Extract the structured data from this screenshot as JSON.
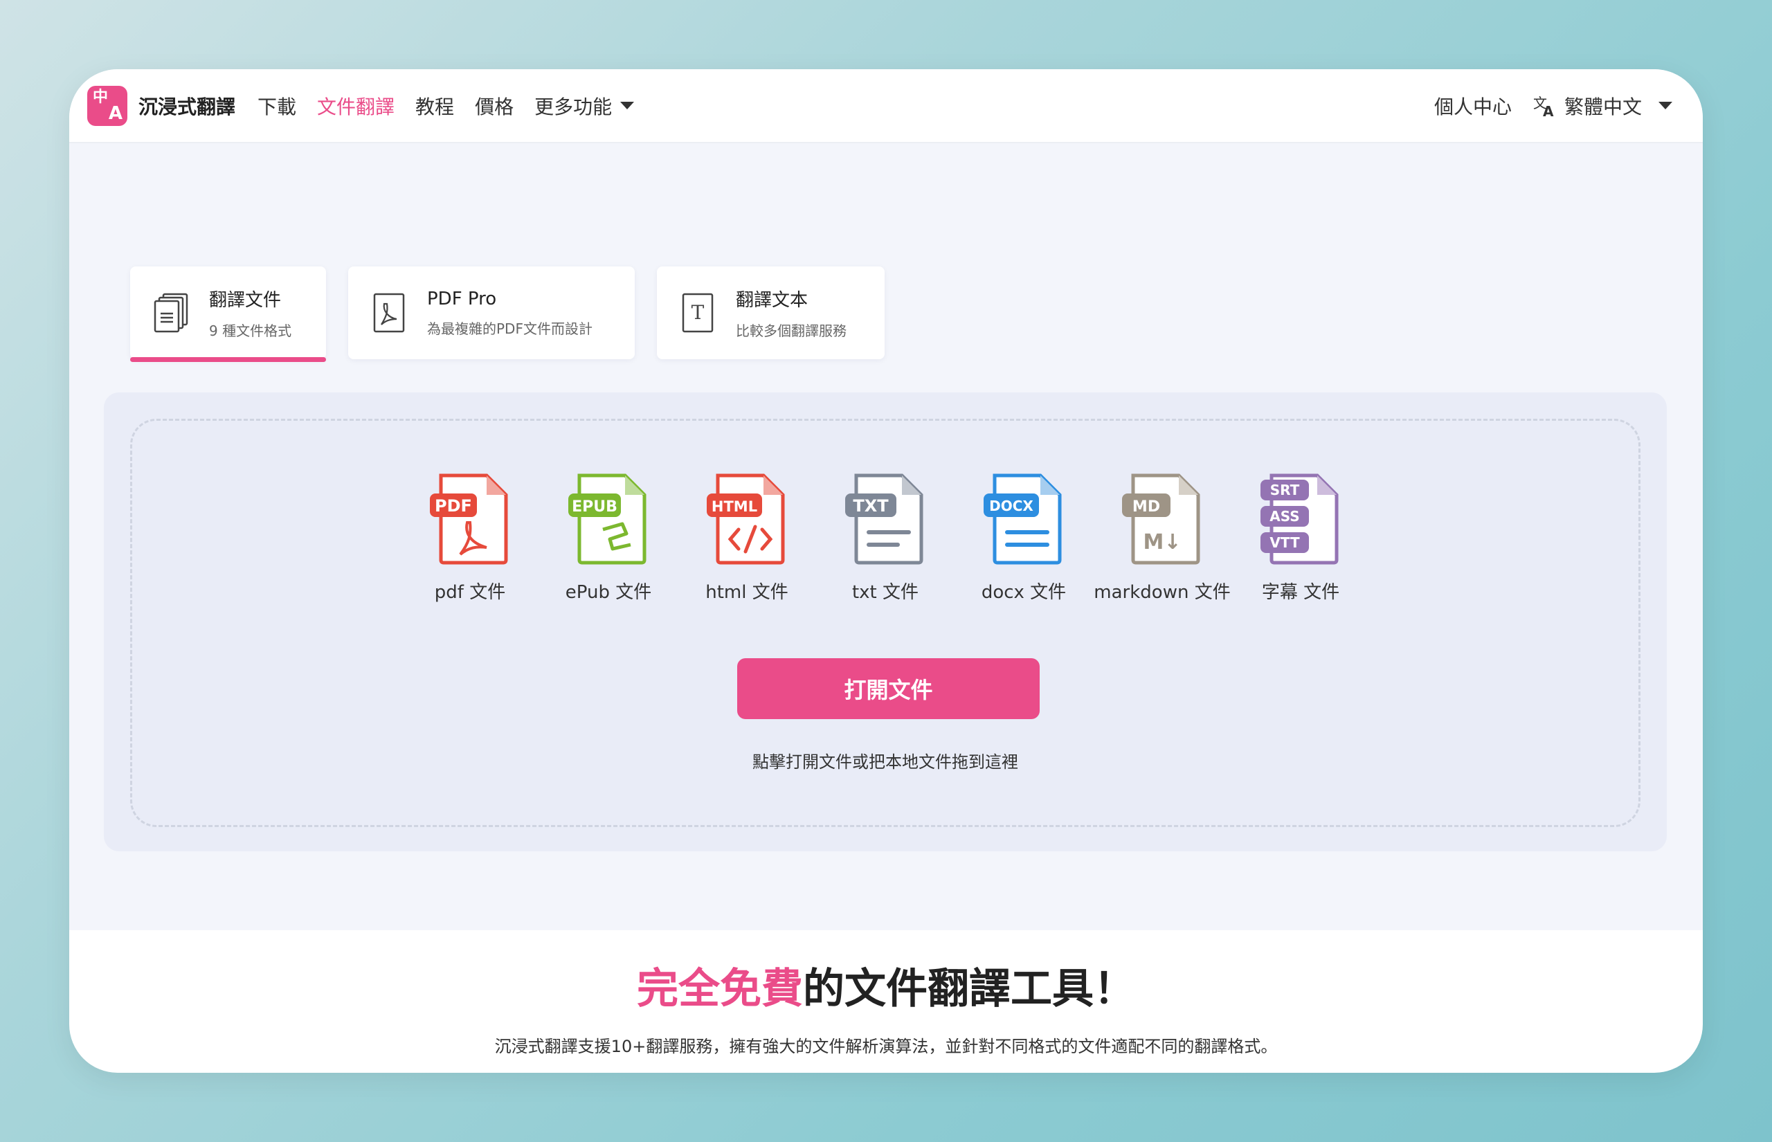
{
  "header": {
    "brand": "沉浸式翻譯",
    "nav": [
      {
        "label": "下載",
        "active": false
      },
      {
        "label": "文件翻譯",
        "active": true
      },
      {
        "label": "教程",
        "active": false
      },
      {
        "label": "價格",
        "active": false
      },
      {
        "label": "更多功能",
        "active": false,
        "dropdown": true
      }
    ],
    "user_center": "個人中心",
    "language": "繁體中文"
  },
  "tabs": [
    {
      "title": "翻譯文件",
      "subtitle": "9 種文件格式",
      "icon": "documents-icon",
      "active": true
    },
    {
      "title": "PDF Pro",
      "subtitle": "為最複雜的PDF文件而設計",
      "icon": "pdf-acrobat-icon",
      "active": false
    },
    {
      "title": "翻譯文本",
      "subtitle": "比較多個翻譯服務",
      "icon": "text-icon",
      "active": false
    }
  ],
  "formats": [
    {
      "badge": "PDF",
      "label": "pdf 文件",
      "color": "#e64a3b",
      "icon": "pdf-file-icon"
    },
    {
      "badge": "EPUB",
      "label": "ePub 文件",
      "color": "#7cb82f",
      "icon": "epub-file-icon"
    },
    {
      "badge": "HTML",
      "label": "html 文件",
      "color": "#e64a3b",
      "icon": "html-file-icon"
    },
    {
      "badge": "TXT",
      "label": "txt 文件",
      "color": "#7e8796",
      "icon": "txt-file-icon"
    },
    {
      "badge": "DOCX",
      "label": "docx 文件",
      "color": "#2d8ee0",
      "icon": "docx-file-icon"
    },
    {
      "badge": "MD",
      "label": "markdown 文件",
      "color": "#9e9486",
      "icon": "markdown-file-icon"
    },
    {
      "badge": "SRT ASS VTT",
      "label": "字幕 文件",
      "color": "#9474b3",
      "icon": "subtitle-file-icon"
    }
  ],
  "upload": {
    "button": "打開文件",
    "hint": "點擊打開文件或把本地文件拖到這裡"
  },
  "hero": {
    "accent": "完全免費",
    "rest": "的文件翻譯工具！",
    "tagline": "沉浸式翻譯支援10+翻譯服務，擁有強大的文件解析演算法，並針對不同格式的文件適配不同的翻譯格式。"
  },
  "colors": {
    "accent": "#ea4c89",
    "main_bg": "#f3f5fb",
    "panel_bg": "#e9ecf7"
  }
}
